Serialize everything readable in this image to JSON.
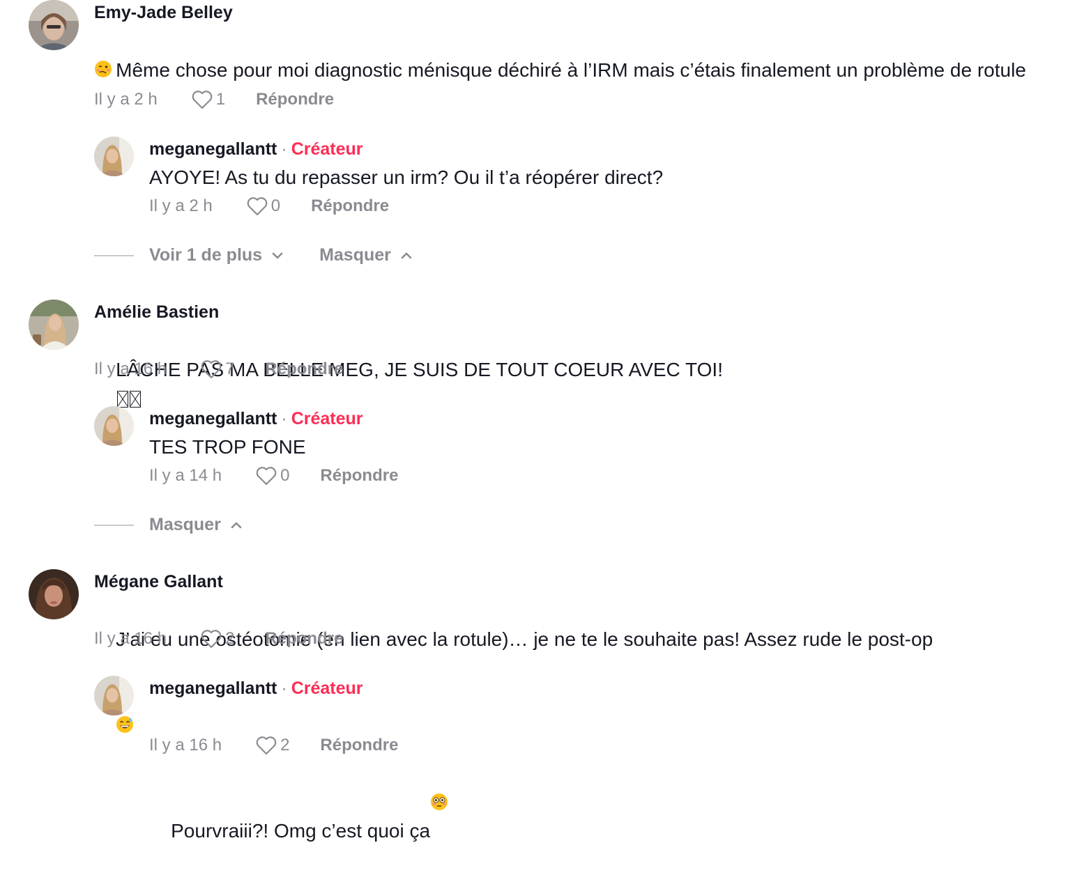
{
  "labels": {
    "creator": "Créateur",
    "reply": "Répondre",
    "view_more": "Voir 1 de plus",
    "hide": "Masquer"
  },
  "colors": {
    "creator": "#fe2c55",
    "muted": "#8a8b91",
    "text": "#161823"
  },
  "icons": {
    "like": "heart-outline-icon",
    "expand": "chevron-down-icon",
    "collapse": "chevron-up-icon"
  },
  "comments": [
    {
      "author": "Emy-Jade Belley",
      "text_line1": "Même chose pour moi diagnostic ménisque déchiré à l’IRM mais c’étais finalement un problème de rotule",
      "emoji": "woozy-face-emoji",
      "time": "Il y a 2 h",
      "likes": "1",
      "reply": {
        "author": "meganegallantt",
        "text": "AYOYE! As tu du repasser un irm? Ou il t’a réopérer direct?",
        "time": "Il y a 2 h",
        "likes": "0"
      }
    },
    {
      "author": "Amélie Bastien",
      "text": "LÂCHE PAS MA BELLE MEG, JE SUIS DE TOUT COEUR AVEC TOI!",
      "time": "Il y a 16 h",
      "likes": "7",
      "reply": {
        "author": "meganegallantt",
        "text": "TES TROP FONE",
        "time": "Il y a 14 h",
        "likes": "0"
      }
    },
    {
      "author": "Mégane Gallant",
      "text": "J’ai eu une ostéotomie (en lien avec la rotule)… je ne te le souhaite pas! Assez rude le post-op",
      "emoji": "grinning-sweat-emoji",
      "time": "Il y a 16 h",
      "likes": "2",
      "reply": {
        "author": "meganegallantt",
        "text": "Pourvraiii?! Omg c’est quoi ça",
        "emoji": "flushed-face-emoji",
        "time": "Il y a 16 h",
        "likes": "2"
      }
    }
  ]
}
